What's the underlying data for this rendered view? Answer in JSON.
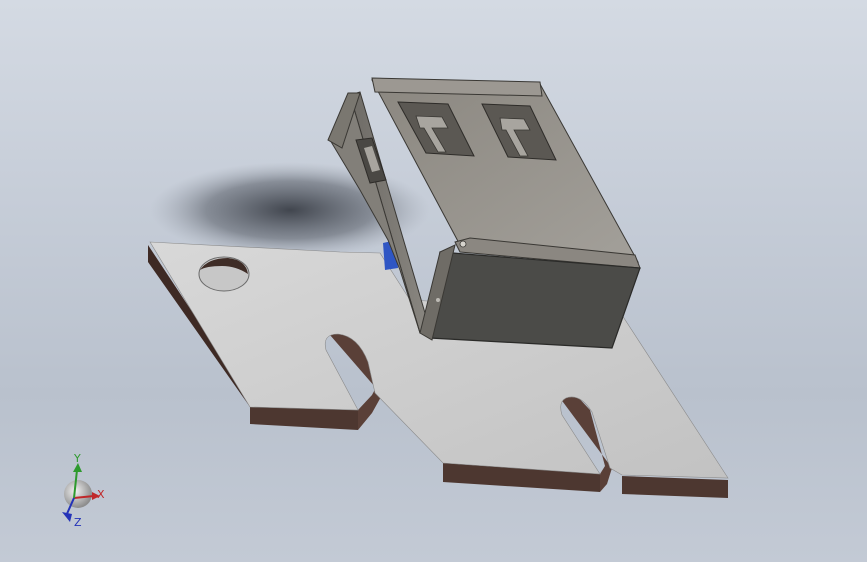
{
  "viewport": {
    "background_top": "#d4dae3",
    "background_bottom": "#b9c1cd"
  },
  "model": {
    "plate_color": "#c9c9c9",
    "plate_edge_color": "#4a3630",
    "connector_shell_color": "#8f8c86",
    "connector_face_color": "#4a4a47",
    "contact_color": "#2f56c4"
  },
  "triad": {
    "x_label": "X",
    "y_label": "Y",
    "z_label": "Z",
    "x_color": "#c0282a",
    "y_color": "#2e9a2e",
    "z_color": "#2433b8"
  }
}
